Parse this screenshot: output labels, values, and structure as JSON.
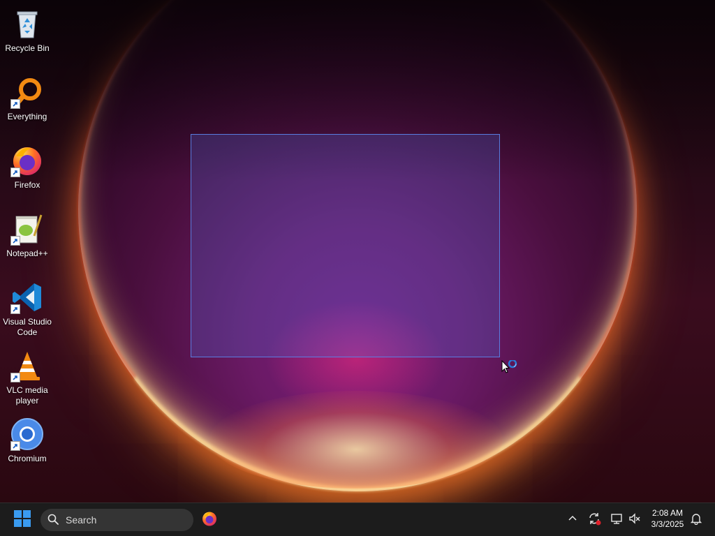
{
  "desktop": {
    "icons": [
      {
        "label": "Recycle Bin"
      },
      {
        "label": "Everything"
      },
      {
        "label": "Firefox"
      },
      {
        "label": "Notepad++"
      },
      {
        "label": "Visual Studio Code"
      },
      {
        "label": "VLC media player"
      },
      {
        "label": "Chromium"
      }
    ]
  },
  "taskbar": {
    "search_placeholder": "Search",
    "pinned": [
      {
        "icon": "firefox-icon"
      }
    ],
    "tray_icons": [
      "chevron-up-icon",
      "sync-icon",
      "network-icon",
      "volume-muted-icon"
    ],
    "clock": {
      "time": "2:08 AM",
      "date": "3/3/2025"
    },
    "notification_icon": "bell-icon"
  },
  "colors": {
    "taskbar_bg": "#1c1c1c",
    "selection_fill": "#5064d2",
    "selection_border": "#5a82e6",
    "windows_blue": "#0078d4"
  }
}
